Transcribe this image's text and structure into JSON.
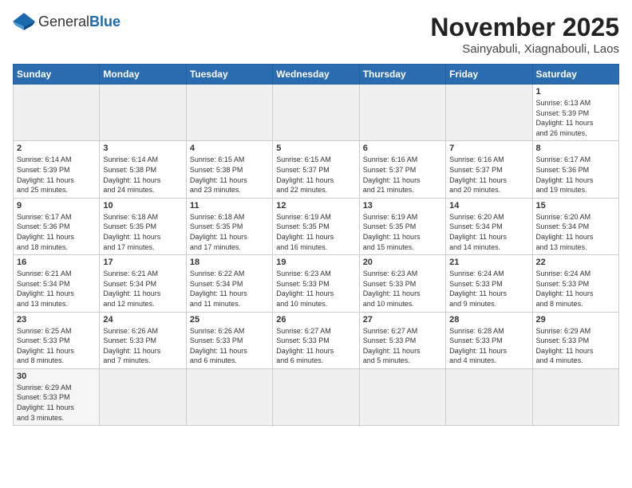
{
  "logo": {
    "general": "General",
    "blue": "Blue"
  },
  "title": {
    "month": "November 2025",
    "location": "Sainyabuli, Xiagnabouli, Laos"
  },
  "headers": [
    "Sunday",
    "Monday",
    "Tuesday",
    "Wednesday",
    "Thursday",
    "Friday",
    "Saturday"
  ],
  "weeks": [
    [
      {
        "day": "",
        "info": ""
      },
      {
        "day": "",
        "info": ""
      },
      {
        "day": "",
        "info": ""
      },
      {
        "day": "",
        "info": ""
      },
      {
        "day": "",
        "info": ""
      },
      {
        "day": "",
        "info": ""
      },
      {
        "day": "1",
        "info": "Sunrise: 6:13 AM\nSunset: 5:39 PM\nDaylight: 11 hours\nand 26 minutes."
      }
    ],
    [
      {
        "day": "2",
        "info": "Sunrise: 6:14 AM\nSunset: 5:39 PM\nDaylight: 11 hours\nand 25 minutes."
      },
      {
        "day": "3",
        "info": "Sunrise: 6:14 AM\nSunset: 5:38 PM\nDaylight: 11 hours\nand 24 minutes."
      },
      {
        "day": "4",
        "info": "Sunrise: 6:15 AM\nSunset: 5:38 PM\nDaylight: 11 hours\nand 23 minutes."
      },
      {
        "day": "5",
        "info": "Sunrise: 6:15 AM\nSunset: 5:37 PM\nDaylight: 11 hours\nand 22 minutes."
      },
      {
        "day": "6",
        "info": "Sunrise: 6:16 AM\nSunset: 5:37 PM\nDaylight: 11 hours\nand 21 minutes."
      },
      {
        "day": "7",
        "info": "Sunrise: 6:16 AM\nSunset: 5:37 PM\nDaylight: 11 hours\nand 20 minutes."
      },
      {
        "day": "8",
        "info": "Sunrise: 6:17 AM\nSunset: 5:36 PM\nDaylight: 11 hours\nand 19 minutes."
      }
    ],
    [
      {
        "day": "9",
        "info": "Sunrise: 6:17 AM\nSunset: 5:36 PM\nDaylight: 11 hours\nand 18 minutes."
      },
      {
        "day": "10",
        "info": "Sunrise: 6:18 AM\nSunset: 5:35 PM\nDaylight: 11 hours\nand 17 minutes."
      },
      {
        "day": "11",
        "info": "Sunrise: 6:18 AM\nSunset: 5:35 PM\nDaylight: 11 hours\nand 17 minutes."
      },
      {
        "day": "12",
        "info": "Sunrise: 6:19 AM\nSunset: 5:35 PM\nDaylight: 11 hours\nand 16 minutes."
      },
      {
        "day": "13",
        "info": "Sunrise: 6:19 AM\nSunset: 5:35 PM\nDaylight: 11 hours\nand 15 minutes."
      },
      {
        "day": "14",
        "info": "Sunrise: 6:20 AM\nSunset: 5:34 PM\nDaylight: 11 hours\nand 14 minutes."
      },
      {
        "day": "15",
        "info": "Sunrise: 6:20 AM\nSunset: 5:34 PM\nDaylight: 11 hours\nand 13 minutes."
      }
    ],
    [
      {
        "day": "16",
        "info": "Sunrise: 6:21 AM\nSunset: 5:34 PM\nDaylight: 11 hours\nand 13 minutes."
      },
      {
        "day": "17",
        "info": "Sunrise: 6:21 AM\nSunset: 5:34 PM\nDaylight: 11 hours\nand 12 minutes."
      },
      {
        "day": "18",
        "info": "Sunrise: 6:22 AM\nSunset: 5:34 PM\nDaylight: 11 hours\nand 11 minutes."
      },
      {
        "day": "19",
        "info": "Sunrise: 6:23 AM\nSunset: 5:33 PM\nDaylight: 11 hours\nand 10 minutes."
      },
      {
        "day": "20",
        "info": "Sunrise: 6:23 AM\nSunset: 5:33 PM\nDaylight: 11 hours\nand 10 minutes."
      },
      {
        "day": "21",
        "info": "Sunrise: 6:24 AM\nSunset: 5:33 PM\nDaylight: 11 hours\nand 9 minutes."
      },
      {
        "day": "22",
        "info": "Sunrise: 6:24 AM\nSunset: 5:33 PM\nDaylight: 11 hours\nand 8 minutes."
      }
    ],
    [
      {
        "day": "23",
        "info": "Sunrise: 6:25 AM\nSunset: 5:33 PM\nDaylight: 11 hours\nand 8 minutes."
      },
      {
        "day": "24",
        "info": "Sunrise: 6:26 AM\nSunset: 5:33 PM\nDaylight: 11 hours\nand 7 minutes."
      },
      {
        "day": "25",
        "info": "Sunrise: 6:26 AM\nSunset: 5:33 PM\nDaylight: 11 hours\nand 6 minutes."
      },
      {
        "day": "26",
        "info": "Sunrise: 6:27 AM\nSunset: 5:33 PM\nDaylight: 11 hours\nand 6 minutes."
      },
      {
        "day": "27",
        "info": "Sunrise: 6:27 AM\nSunset: 5:33 PM\nDaylight: 11 hours\nand 5 minutes."
      },
      {
        "day": "28",
        "info": "Sunrise: 6:28 AM\nSunset: 5:33 PM\nDaylight: 11 hours\nand 4 minutes."
      },
      {
        "day": "29",
        "info": "Sunrise: 6:29 AM\nSunset: 5:33 PM\nDaylight: 11 hours\nand 4 minutes."
      }
    ],
    [
      {
        "day": "30",
        "info": "Sunrise: 6:29 AM\nSunset: 5:33 PM\nDaylight: 11 hours\nand 3 minutes."
      },
      {
        "day": "",
        "info": ""
      },
      {
        "day": "",
        "info": ""
      },
      {
        "day": "",
        "info": ""
      },
      {
        "day": "",
        "info": ""
      },
      {
        "day": "",
        "info": ""
      },
      {
        "day": "",
        "info": ""
      }
    ]
  ]
}
